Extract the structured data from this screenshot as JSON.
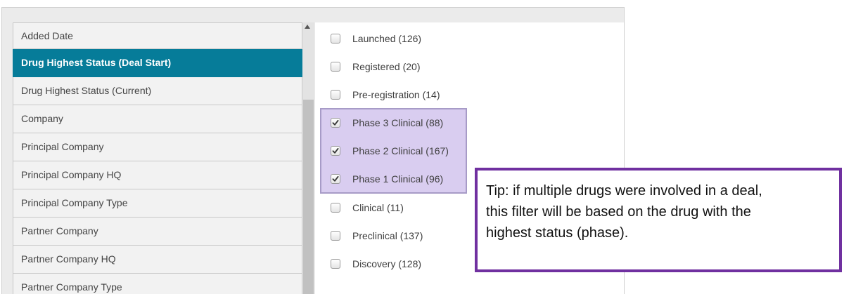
{
  "field_list": {
    "items": [
      {
        "label": "Added Date",
        "selected": false
      },
      {
        "label": "Drug Highest Status (Deal Start)",
        "selected": true
      },
      {
        "label": "Drug Highest Status (Current)",
        "selected": false
      },
      {
        "label": "Company",
        "selected": false
      },
      {
        "label": "Principal Company",
        "selected": false
      },
      {
        "label": "Principal Company HQ",
        "selected": false
      },
      {
        "label": "Principal Company Type",
        "selected": false
      },
      {
        "label": "Partner Company",
        "selected": false
      },
      {
        "label": "Partner Company HQ",
        "selected": false
      },
      {
        "label": "Partner Company Type",
        "selected": false
      }
    ]
  },
  "value_list": {
    "items": [
      {
        "label": "Launched (126)",
        "checked": false
      },
      {
        "label": "Registered (20)",
        "checked": false
      },
      {
        "label": "Pre-registration (14)",
        "checked": false
      },
      {
        "label": "Phase 3 Clinical (88)",
        "checked": true
      },
      {
        "label": "Phase 2 Clinical (167)",
        "checked": true
      },
      {
        "label": "Phase 1 Clinical (96)",
        "checked": true
      },
      {
        "label": "Clinical (11)",
        "checked": false
      },
      {
        "label": "Preclinical (137)",
        "checked": false
      },
      {
        "label": "Discovery (128)",
        "checked": false
      }
    ]
  },
  "tip": {
    "lines": [
      "Tip: if multiple drugs were involved in a deal,",
      "this filter will be based on the drug with the",
      "highest status (phase)."
    ]
  },
  "colors": {
    "selected_field": "#067c99",
    "phase_highlight": "#d9cdf0",
    "tip_border": "#7030a0"
  },
  "icons": {
    "checkbox": "checkbox-icon",
    "checkmark": "checkmark-icon",
    "scroll_up": "scroll-up-arrow-icon"
  }
}
